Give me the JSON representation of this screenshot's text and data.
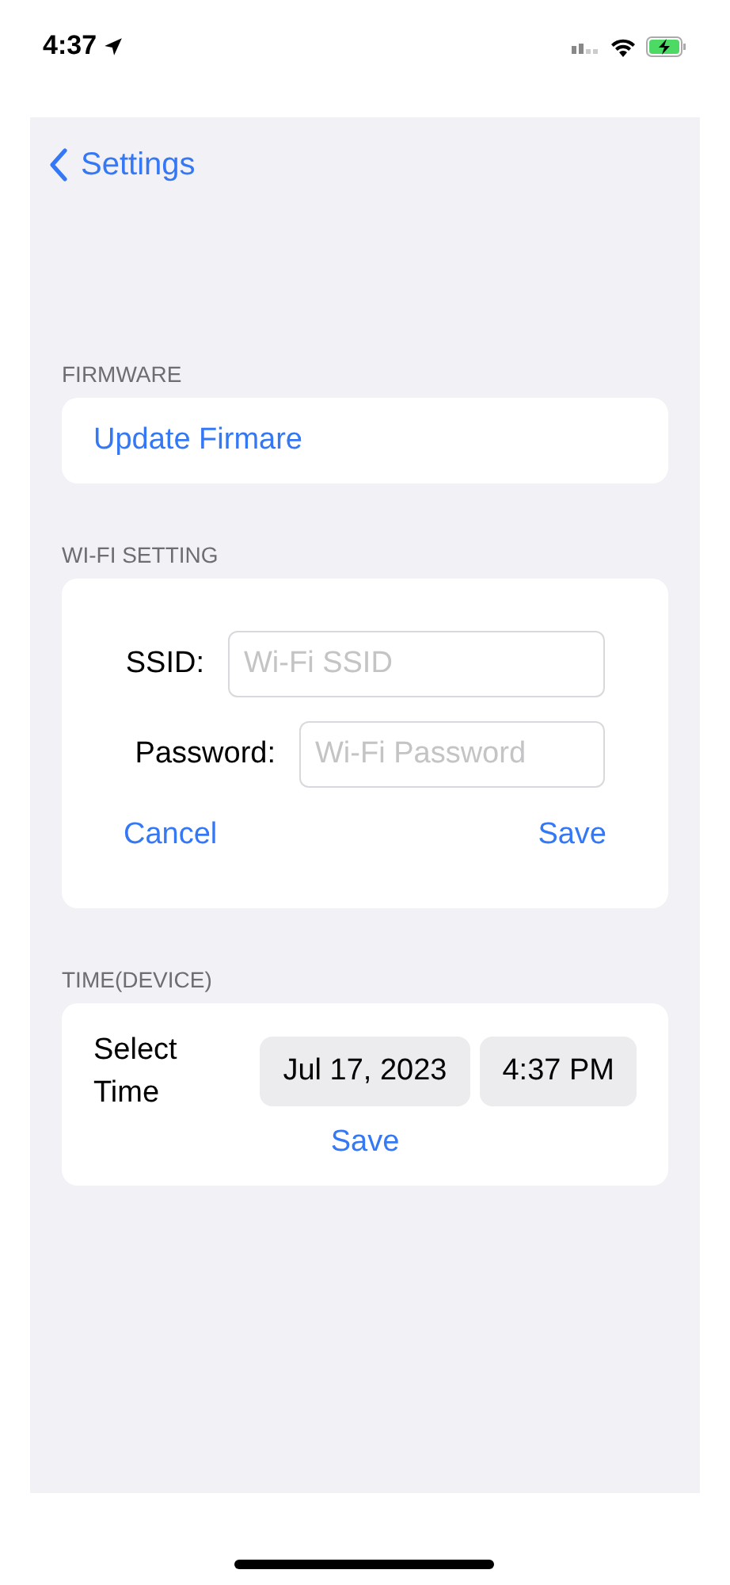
{
  "status_bar": {
    "time": "4:37"
  },
  "nav": {
    "back_label": "Settings"
  },
  "firmware": {
    "header": "FIRMWARE",
    "action": "Update Firmare"
  },
  "wifi": {
    "header": "WI-FI SETTING",
    "fields": [
      {
        "label": "SSID:",
        "placeholder": "Wi-Fi SSID"
      },
      {
        "label": "Password:",
        "placeholder": "Wi-Fi Password"
      }
    ],
    "cancel": "Cancel",
    "save": "Save"
  },
  "time": {
    "header": "TIME(DEVICE)",
    "label": "Select Time",
    "date": "Jul 17, 2023",
    "time": "4:37 PM",
    "save": "Save"
  }
}
